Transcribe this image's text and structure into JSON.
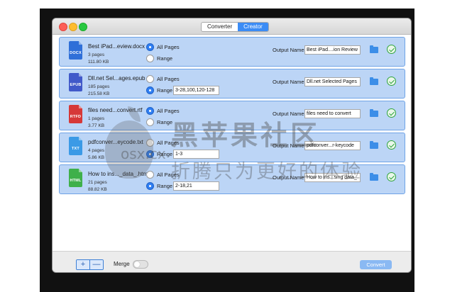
{
  "window": {
    "tabs": [
      {
        "label": "Converter",
        "active": false
      },
      {
        "label": "Creator",
        "active": true
      }
    ]
  },
  "colors": {
    "accent": "#3b8cf5",
    "row_bg": "#bcd5f6",
    "docx": "#2f6fd8",
    "epub": "#4159c9",
    "rtfd": "#d63838",
    "txt": "#3b9ae6",
    "html": "#3fb04a"
  },
  "rows": [
    {
      "file_name": "Best iPad...eview.docx",
      "pages": "3 pages",
      "size": "111.80 KB",
      "badge": "DOCX",
      "all_pages_label": "All Pages",
      "range_label": "Range",
      "selected": "all",
      "range_value": "",
      "output_label": "Output Name",
      "output_value": "Best iPad....ion Review"
    },
    {
      "file_name": "Dll.net Sel...ages.epub",
      "pages": "185 pages",
      "size": "215.58 KB",
      "badge": "EPUB",
      "all_pages_label": "All Pages",
      "range_label": "Range",
      "selected": "range",
      "range_value": "3-28,100,120-128",
      "output_label": "Output Name",
      "output_value": "Dll.net Selected Pages"
    },
    {
      "file_name": "files need...convert.rtf",
      "pages": "1 pages",
      "size": "3.77 KB",
      "badge": "RTFD",
      "all_pages_label": "All Pages",
      "range_label": "Range",
      "selected": "all",
      "range_value": "",
      "output_label": "Output Name",
      "output_value": "files need to convert"
    },
    {
      "file_name": "pdfconver...eycode.txt",
      "pages": "4 pages",
      "size": "5.86 KB",
      "badge": "TXT",
      "all_pages_label": "All Pages",
      "range_label": "Range",
      "selected": "range",
      "range_value": "1-3",
      "output_label": "Output Name",
      "output_value": "pdfconver...r-keycode"
    },
    {
      "file_name": "How to ins..._data_.html",
      "pages": "21 pages",
      "size": "88.82 KB",
      "badge": "HTML",
      "all_pages_label": "All Pages",
      "range_label": "Range",
      "selected": "range",
      "range_value": "2-18,21",
      "output_label": "Output Name",
      "output_value": "How to ins...sing data_"
    }
  ],
  "bottom": {
    "add_label": "+",
    "remove_label": "—",
    "merge_label": "Merge",
    "merge_on": false,
    "convert_label": "Convert"
  },
  "watermark": {
    "title_cn": "黑苹果社区",
    "subtitle_cn": "折腾只为更好的体验",
    "domain": "osx.cx"
  }
}
